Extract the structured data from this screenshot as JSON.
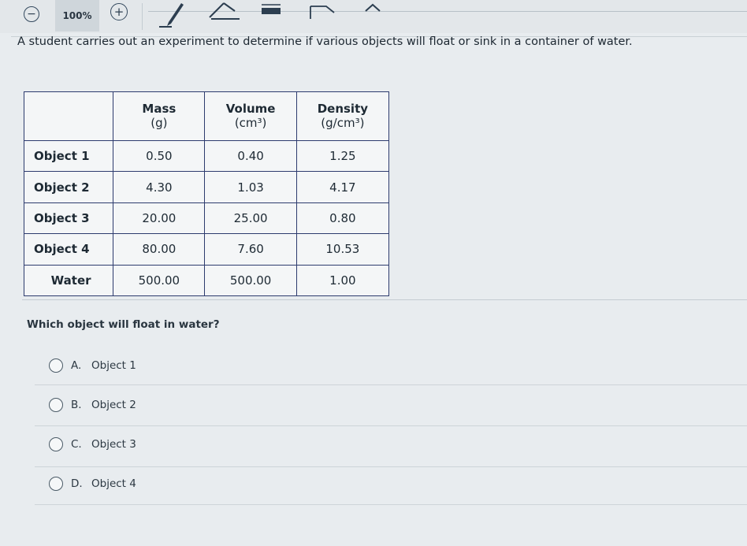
{
  "toolbar": {
    "zoom_out_symbol": "−",
    "zoom_level": "100%",
    "zoom_in_symbol": "+"
  },
  "prompt": "A student carries out an experiment to determine if various objects will float or sink in a container of water.",
  "table": {
    "headers": [
      {
        "line1": "",
        "line2": ""
      },
      {
        "line1": "Mass",
        "line2": "(g)"
      },
      {
        "line1": "Volume",
        "line2": "(cm³)"
      },
      {
        "line1": "Density",
        "line2": "(g/cm³)"
      }
    ],
    "rows": [
      {
        "label": "Object 1",
        "mass": "0.50",
        "volume": "0.40",
        "density": "1.25"
      },
      {
        "label": "Object 2",
        "mass": "4.30",
        "volume": "1.03",
        "density": "4.17"
      },
      {
        "label": "Object 3",
        "mass": "20.00",
        "volume": "25.00",
        "density": "0.80"
      },
      {
        "label": "Object 4",
        "mass": "80.00",
        "volume": "7.60",
        "density": "10.53"
      },
      {
        "label": "Water",
        "mass": "500.00",
        "volume": "500.00",
        "density": "1.00"
      }
    ]
  },
  "question": "Which object will float in water?",
  "choices": [
    {
      "letter": "A.",
      "text": "Object 1"
    },
    {
      "letter": "B.",
      "text": "Object 2"
    },
    {
      "letter": "C.",
      "text": "Object 3"
    },
    {
      "letter": "D.",
      "text": "Object 4"
    }
  ],
  "icons": {
    "zoom_out": "minus-circle-icon",
    "zoom_in": "plus-circle-icon",
    "pen": "pen-icon",
    "eraser": "eraser-icon",
    "highlighter": "highlighter-icon",
    "note": "note-icon",
    "collapse": "chevron-up-icon"
  },
  "colors": {
    "table_border": "#2d3b6e",
    "background": "#e8ecef",
    "zoom_level_bg": "#cfd6db"
  }
}
